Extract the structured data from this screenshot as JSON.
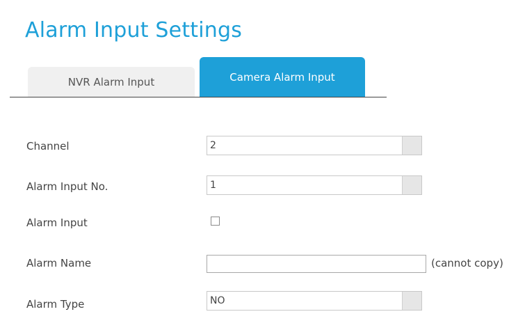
{
  "page": {
    "title": "Alarm Input Settings"
  },
  "tabs": [
    {
      "label": "NVR Alarm Input",
      "active": false
    },
    {
      "label": "Camera Alarm Input",
      "active": true
    }
  ],
  "form": {
    "channel": {
      "label": "Channel",
      "value": "2"
    },
    "alarm_input_no": {
      "label": "Alarm Input No.",
      "value": "1"
    },
    "alarm_input": {
      "label": "Alarm Input",
      "checked": false
    },
    "alarm_name": {
      "label": "Alarm Name",
      "value": "",
      "note": "(cannot copy)"
    },
    "alarm_type": {
      "label": "Alarm Type",
      "value": "NO"
    }
  },
  "colors": {
    "accent": "#1ea0d8",
    "text": "#444444",
    "inactive_tab_bg": "#f0f0f0"
  }
}
